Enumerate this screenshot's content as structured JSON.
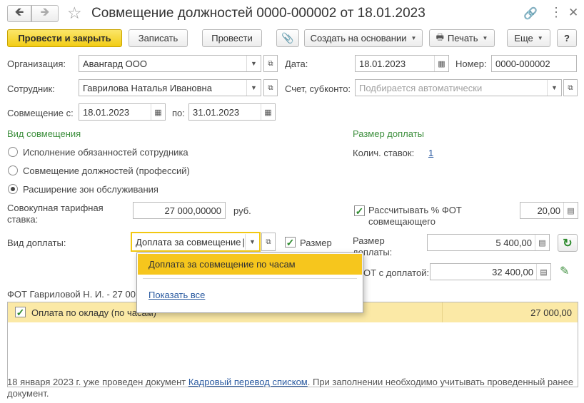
{
  "window": {
    "title": "Совмещение должностей 0000-000002 от 18.01.2023"
  },
  "toolbar": {
    "post_close": "Провести и закрыть",
    "save": "Записать",
    "post": "Провести",
    "create_based": "Создать на основании",
    "print": "Печать",
    "more": "Еще",
    "help": "?"
  },
  "form": {
    "org_label": "Организация:",
    "org_value": "Авангард ООО",
    "date_label": "Дата:",
    "date_value": "18.01.2023",
    "number_label": "Номер:",
    "number_value": "0000-000002",
    "employee_label": "Сотрудник:",
    "employee_value": "Гаврилова Наталья Ивановна",
    "account_label": "Счет, субконто:",
    "account_placeholder": "Подбирается автоматически",
    "combo_from_label": "Совмещение с:",
    "combo_from_value": "18.01.2023",
    "combo_to_label": "по:",
    "combo_to_value": "31.01.2023"
  },
  "combination_type": {
    "header": "Вид совмещения",
    "options": [
      {
        "label": "Исполнение обязанностей сотрудника",
        "selected": false
      },
      {
        "label": "Совмещение должностей (профессий)",
        "selected": false
      },
      {
        "label": "Расширение зон обслуживания",
        "selected": true
      }
    ]
  },
  "surcharge": {
    "header": "Размер доплаты",
    "rates_label": "Колич. ставок:",
    "rates_value": "1",
    "tariff_label_1": "Совокупная тарифная",
    "tariff_label_2": "ставка:",
    "tariff_value": "27 000,00000",
    "tariff_unit": "руб.",
    "calc_pct_label_1": "Рассчитывать % ФОТ",
    "calc_pct_label_2": "совмещающего",
    "calc_pct_checked": true,
    "pct_value": "20,00",
    "kind_label": "Вид доплаты:",
    "kind_value": "Доплата за совмещение",
    "size_check_label": "Размер",
    "size_check_checked": true,
    "amount_label_1": "Размер",
    "amount_label_2": "доплаты:",
    "amount_value": "5 400,00",
    "fot_label": "ФОТ с доплатой:",
    "fot_visible_label": "ОТ с доплатой:",
    "fot_value": "32 400,00"
  },
  "dropdown": {
    "items": [
      "Доплата за совмещение по часам"
    ],
    "show_all": "Показать все"
  },
  "fot_section": {
    "title": "ФОТ Гавриловой Н. И. - 27 00",
    "rows": [
      {
        "checked": true,
        "name": "Оплата по окладу (по часам)",
        "visible_name": "Оплата по окладу (по часам)",
        "amount": "27 000,00"
      }
    ]
  },
  "footer": {
    "text_before": "18 января 2023 г. уже проведен документ ",
    "link": "Кадровый перевод списком",
    "text_after": ". При заполнении необходимо учитывать проведенный ранее документ."
  }
}
